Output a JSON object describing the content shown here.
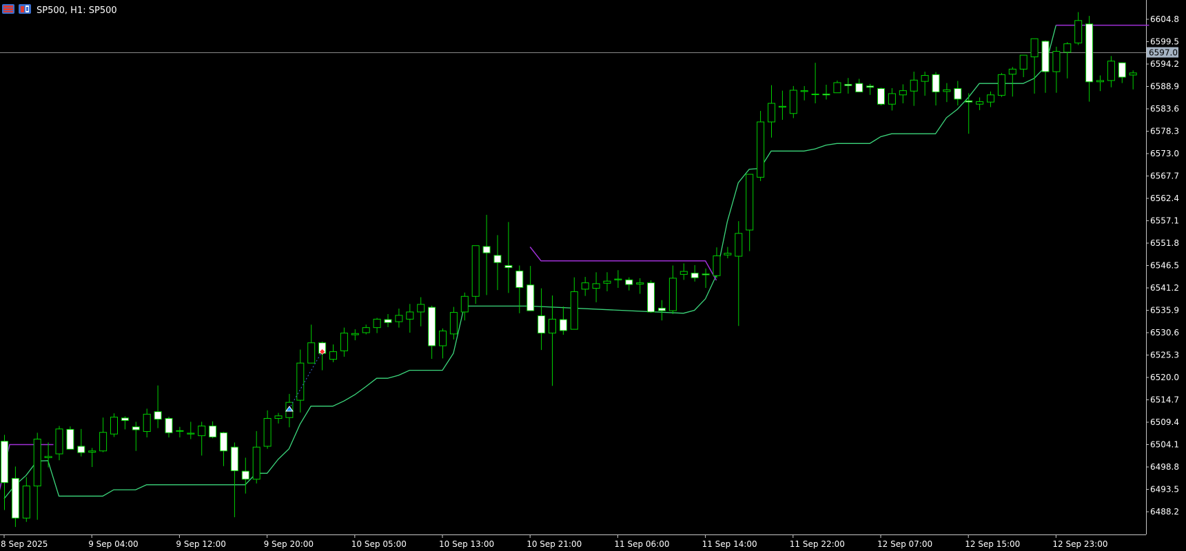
{
  "window": {
    "title": "SP500, H1:  SP500",
    "icons": [
      "chart-grid-icon",
      "one-click-trading-icon"
    ]
  },
  "colors": {
    "background": "#000000",
    "bull_body": "#000000",
    "bear_body": "#ffffff",
    "candle_wick": "#00d200",
    "lower_line": "#3cd77c",
    "upper_line": "#a030d8",
    "bid_line": "#8a8a8a",
    "axis": "#c8c8c8",
    "price_tag": "#a6b4c4",
    "buy_arrow": "#1e90ff",
    "sell_arrow": "#ff3030"
  },
  "chart_data": {
    "type": "candlestick",
    "symbol": "SP500",
    "timeframe": "H1",
    "current_price": "6597.0",
    "y_ticks": [
      "6604.8",
      "6599.5",
      "6594.2",
      "6588.9",
      "6583.6",
      "6578.3",
      "6573.0",
      "6567.7",
      "6562.4",
      "6557.1",
      "6551.8",
      "6546.5",
      "6541.2",
      "6535.9",
      "6530.6",
      "6525.3",
      "6520.0",
      "6514.7",
      "6509.4",
      "6504.1",
      "6498.8",
      "6493.5",
      "6488.2"
    ],
    "ylim": [
      6484.2,
      6607.3
    ],
    "x_ticks": [
      {
        "label": "8 Sep 2025",
        "bar": 0
      },
      {
        "label": "9 Sep 04:00",
        "bar": 8
      },
      {
        "label": "9 Sep 12:00",
        "bar": 16
      },
      {
        "label": "9 Sep 20:00",
        "bar": 24
      },
      {
        "label": "10 Sep 05:00",
        "bar": 32
      },
      {
        "label": "10 Sep 13:00",
        "bar": 40
      },
      {
        "label": "10 Sep 21:00",
        "bar": 48
      },
      {
        "label": "11 Sep 06:00",
        "bar": 56
      },
      {
        "label": "11 Sep 14:00",
        "bar": 64
      },
      {
        "label": "11 Sep 22:00",
        "bar": 72
      },
      {
        "label": "12 Sep 07:00",
        "bar": 80
      },
      {
        "label": "12 Sep 15:00",
        "bar": 88
      },
      {
        "label": "12 Sep 23:00",
        "bar": 96
      }
    ],
    "candles": [
      {
        "o": 6504.9,
        "h": 6506.4,
        "l": 6488.6,
        "c": 6495.1
      },
      {
        "o": 6496.1,
        "h": 6498.9,
        "l": 6484.6,
        "c": 6486.7
      },
      {
        "o": 6486.7,
        "h": 6496.4,
        "l": 6485.8,
        "c": 6494.3
      },
      {
        "o": 6494.3,
        "h": 6506.9,
        "l": 6486.3,
        "c": 6505.4
      },
      {
        "o": 6501.0,
        "h": 6504.6,
        "l": 6498.7,
        "c": 6501.3
      },
      {
        "o": 6501.9,
        "h": 6508.5,
        "l": 6500.4,
        "c": 6507.8
      },
      {
        "o": 6507.7,
        "h": 6508.4,
        "l": 6504.0,
        "c": 6503.0
      },
      {
        "o": 6503.7,
        "h": 6507.8,
        "l": 6501.3,
        "c": 6502.2
      },
      {
        "o": 6502.3,
        "h": 6503.3,
        "l": 6498.8,
        "c": 6502.6
      },
      {
        "o": 6502.6,
        "h": 6510.5,
        "l": 6502.3,
        "c": 6507.0
      },
      {
        "o": 6506.6,
        "h": 6511.5,
        "l": 6505.9,
        "c": 6510.6
      },
      {
        "o": 6510.4,
        "h": 6510.8,
        "l": 6507.7,
        "c": 6509.8
      },
      {
        "o": 6508.3,
        "h": 6509.5,
        "l": 6502.6,
        "c": 6507.6
      },
      {
        "o": 6507.2,
        "h": 6512.6,
        "l": 6505.8,
        "c": 6511.3
      },
      {
        "o": 6511.9,
        "h": 6518.1,
        "l": 6508.0,
        "c": 6510.1
      },
      {
        "o": 6510.3,
        "h": 6510.7,
        "l": 6505.8,
        "c": 6506.9
      },
      {
        "o": 6507.3,
        "h": 6508.3,
        "l": 6505.8,
        "c": 6507.4
      },
      {
        "o": 6506.6,
        "h": 6509.5,
        "l": 6505.4,
        "c": 6506.8
      },
      {
        "o": 6506.2,
        "h": 6509.5,
        "l": 6501.5,
        "c": 6508.5
      },
      {
        "o": 6508.5,
        "h": 6509.6,
        "l": 6505.6,
        "c": 6505.9
      },
      {
        "o": 6506.9,
        "h": 6507.1,
        "l": 6499.0,
        "c": 6502.6
      },
      {
        "o": 6503.5,
        "h": 6504.6,
        "l": 6486.9,
        "c": 6497.9
      },
      {
        "o": 6497.8,
        "h": 6501.0,
        "l": 6492.5,
        "c": 6495.9
      },
      {
        "o": 6495.9,
        "h": 6507.3,
        "l": 6494.9,
        "c": 6503.5
      },
      {
        "o": 6503.7,
        "h": 6512.2,
        "l": 6503.1,
        "c": 6510.3
      },
      {
        "o": 6510.3,
        "h": 6511.6,
        "l": 6509.1,
        "c": 6510.9
      },
      {
        "o": 6510.5,
        "h": 6516.1,
        "l": 6508.2,
        "c": 6514.1
      },
      {
        "o": 6514.6,
        "h": 6526.6,
        "l": 6511.7,
        "c": 6523.4
      },
      {
        "o": 6523.4,
        "h": 6532.5,
        "l": 6524.5,
        "c": 6528.2
      },
      {
        "o": 6528.2,
        "h": 6528.5,
        "l": 6521.7,
        "c": 6525.7
      },
      {
        "o": 6524.3,
        "h": 6527.8,
        "l": 6523.6,
        "c": 6526.1
      },
      {
        "o": 6526.3,
        "h": 6531.8,
        "l": 6524.9,
        "c": 6530.5
      },
      {
        "o": 6530.1,
        "h": 6531.4,
        "l": 6528.8,
        "c": 6530.4
      },
      {
        "o": 6530.6,
        "h": 6532.5,
        "l": 6530.2,
        "c": 6531.8
      },
      {
        "o": 6531.8,
        "h": 6534.1,
        "l": 6530.5,
        "c": 6533.8
      },
      {
        "o": 6533.7,
        "h": 6535.0,
        "l": 6531.9,
        "c": 6533.0
      },
      {
        "o": 6533.2,
        "h": 6536.3,
        "l": 6531.8,
        "c": 6534.7
      },
      {
        "o": 6533.8,
        "h": 6537.4,
        "l": 6530.6,
        "c": 6535.5
      },
      {
        "o": 6535.5,
        "h": 6539.0,
        "l": 6532.1,
        "c": 6537.3
      },
      {
        "o": 6536.6,
        "h": 6537.0,
        "l": 6524.4,
        "c": 6527.5
      },
      {
        "o": 6527.5,
        "h": 6531.6,
        "l": 6524.5,
        "c": 6531.0
      },
      {
        "o": 6530.3,
        "h": 6536.7,
        "l": 6529.0,
        "c": 6535.4
      },
      {
        "o": 6535.5,
        "h": 6540.1,
        "l": 6533.5,
        "c": 6539.2
      },
      {
        "o": 6539.2,
        "h": 6550.7,
        "l": 6537.4,
        "c": 6551.2
      },
      {
        "o": 6551.0,
        "h": 6558.5,
        "l": 6539.5,
        "c": 6549.5
      },
      {
        "o": 6548.9,
        "h": 6553.7,
        "l": 6540.7,
        "c": 6547.2
      },
      {
        "o": 6546.5,
        "h": 6556.8,
        "l": 6540.0,
        "c": 6546.0
      },
      {
        "o": 6545.2,
        "h": 6546.5,
        "l": 6535.2,
        "c": 6541.3
      },
      {
        "o": 6541.9,
        "h": 6546.4,
        "l": 6536.5,
        "c": 6535.8
      },
      {
        "o": 6534.6,
        "h": 6541.1,
        "l": 6526.5,
        "c": 6530.5
      },
      {
        "o": 6530.5,
        "h": 6539.4,
        "l": 6518.0,
        "c": 6533.8
      },
      {
        "o": 6533.7,
        "h": 6536.8,
        "l": 6530.1,
        "c": 6531.1
      },
      {
        "o": 6531.4,
        "h": 6543.7,
        "l": 6533.4,
        "c": 6540.3
      },
      {
        "o": 6540.9,
        "h": 6543.8,
        "l": 6539.3,
        "c": 6542.4
      },
      {
        "o": 6541.1,
        "h": 6544.9,
        "l": 6537.8,
        "c": 6542.2
      },
      {
        "o": 6542.3,
        "h": 6544.9,
        "l": 6540.4,
        "c": 6542.8
      },
      {
        "o": 6543.1,
        "h": 6545.4,
        "l": 6541.2,
        "c": 6543.3
      },
      {
        "o": 6543.1,
        "h": 6543.7,
        "l": 6540.6,
        "c": 6542.0
      },
      {
        "o": 6542.1,
        "h": 6543.5,
        "l": 6539.8,
        "c": 6542.4
      },
      {
        "o": 6542.4,
        "h": 6543.0,
        "l": 6535.3,
        "c": 6535.5
      },
      {
        "o": 6536.4,
        "h": 6538.3,
        "l": 6533.5,
        "c": 6535.8
      },
      {
        "o": 6535.8,
        "h": 6546.5,
        "l": 6535.0,
        "c": 6543.5
      },
      {
        "o": 6544.4,
        "h": 6547.0,
        "l": 6543.1,
        "c": 6545.1
      },
      {
        "o": 6544.7,
        "h": 6546.6,
        "l": 6542.7,
        "c": 6543.6
      },
      {
        "o": 6544.5,
        "h": 6545.8,
        "l": 6541.2,
        "c": 6544.3
      },
      {
        "o": 6544.1,
        "h": 6550.8,
        "l": 6543.5,
        "c": 6548.8
      },
      {
        "o": 6549.0,
        "h": 6550.9,
        "l": 6548.2,
        "c": 6549.4
      },
      {
        "o": 6548.7,
        "h": 6557.0,
        "l": 6532.2,
        "c": 6554.1
      },
      {
        "o": 6554.9,
        "h": 6560.8,
        "l": 6549.9,
        "c": 6568.1
      },
      {
        "o": 6567.4,
        "h": 6583.1,
        "l": 6566.5,
        "c": 6580.5
      },
      {
        "o": 6580.5,
        "h": 6589.2,
        "l": 6576.8,
        "c": 6584.9
      },
      {
        "o": 6584.0,
        "h": 6587.9,
        "l": 6581.0,
        "c": 6584.2
      },
      {
        "o": 6582.5,
        "h": 6589.0,
        "l": 6581.4,
        "c": 6588.0
      },
      {
        "o": 6587.7,
        "h": 6589.0,
        "l": 6585.6,
        "c": 6587.9
      },
      {
        "o": 6587.0,
        "h": 6594.5,
        "l": 6584.9,
        "c": 6587.1
      },
      {
        "o": 6587.1,
        "h": 6589.3,
        "l": 6585.8,
        "c": 6586.9
      },
      {
        "o": 6587.4,
        "h": 6590.3,
        "l": 6587.5,
        "c": 6589.8
      },
      {
        "o": 6589.4,
        "h": 6590.9,
        "l": 6587.2,
        "c": 6589.1
      },
      {
        "o": 6589.6,
        "h": 6590.7,
        "l": 6587.6,
        "c": 6587.6
      },
      {
        "o": 6589.0,
        "h": 6589.5,
        "l": 6586.9,
        "c": 6588.7
      },
      {
        "o": 6588.4,
        "h": 6588.6,
        "l": 6584.4,
        "c": 6584.7
      },
      {
        "o": 6584.7,
        "h": 6588.5,
        "l": 6583.2,
        "c": 6587.2
      },
      {
        "o": 6586.9,
        "h": 6589.4,
        "l": 6584.9,
        "c": 6587.9
      },
      {
        "o": 6587.8,
        "h": 6592.4,
        "l": 6584.3,
        "c": 6590.4
      },
      {
        "o": 6590.1,
        "h": 6592.4,
        "l": 6586.7,
        "c": 6591.5
      },
      {
        "o": 6591.7,
        "h": 6592.3,
        "l": 6584.4,
        "c": 6587.6
      },
      {
        "o": 6587.7,
        "h": 6589.7,
        "l": 6585.2,
        "c": 6588.1
      },
      {
        "o": 6588.4,
        "h": 6590.2,
        "l": 6584.4,
        "c": 6585.9
      },
      {
        "o": 6585.5,
        "h": 6587.3,
        "l": 6577.7,
        "c": 6585.2
      },
      {
        "o": 6584.7,
        "h": 6586.3,
        "l": 6583.3,
        "c": 6585.3
      },
      {
        "o": 6585.2,
        "h": 6587.7,
        "l": 6584.0,
        "c": 6586.9
      },
      {
        "o": 6586.8,
        "h": 6592.1,
        "l": 6586.4,
        "c": 6591.7
      },
      {
        "o": 6591.8,
        "h": 6593.5,
        "l": 6586.5,
        "c": 6593.0
      },
      {
        "o": 6593.0,
        "h": 6594.6,
        "l": 6591.1,
        "c": 6596.3
      },
      {
        "o": 6595.9,
        "h": 6599.8,
        "l": 6587.2,
        "c": 6600.2
      },
      {
        "o": 6599.6,
        "h": 6599.8,
        "l": 6587.4,
        "c": 6592.4
      },
      {
        "o": 6592.4,
        "h": 6598.3,
        "l": 6587.4,
        "c": 6597.2
      },
      {
        "o": 6597.0,
        "h": 6599.4,
        "l": 6590.8,
        "c": 6599.0
      },
      {
        "o": 6599.2,
        "h": 6606.5,
        "l": 6598.7,
        "c": 6604.5
      },
      {
        "o": 6603.7,
        "h": 6605.6,
        "l": 6585.3,
        "c": 6590.0
      },
      {
        "o": 6590.0,
        "h": 6591.5,
        "l": 6587.8,
        "c": 6590.3
      },
      {
        "o": 6590.3,
        "h": 6596.1,
        "l": 6588.7,
        "c": 6594.9
      },
      {
        "o": 6594.5,
        "h": 6594.6,
        "l": 6589.7,
        "c": 6591.1
      },
      {
        "o": 6591.6,
        "h": 6592.7,
        "l": 6588.2,
        "c": 6592.1
      },
      {
        "o": 6592.1,
        "h": 6594.1,
        "l": 6590.9,
        "c": 6593.6
      },
      {
        "o": 6593.6,
        "h": 6596.2,
        "l": 6592.1,
        "c": 6595.6
      },
      {
        "o": 6595.2,
        "h": 6597.4,
        "l": 6595.4,
        "c": 6597.0
      }
    ],
    "lower_line": [
      {
        "bar": 0,
        "v": 6491.3
      },
      {
        "bar": 1,
        "v": 6494.5
      },
      {
        "bar": 2,
        "v": 6496.8
      },
      {
        "bar": 3,
        "v": 6500.2
      },
      {
        "bar": 4,
        "v": 6500.3
      },
      {
        "bar": 5,
        "v": 6491.9
      },
      {
        "bar": 6,
        "v": 6491.9
      },
      {
        "bar": 7,
        "v": 6491.9
      },
      {
        "bar": 8,
        "v": 6491.9
      },
      {
        "bar": 9,
        "v": 6491.9
      },
      {
        "bar": 10,
        "v": 6493.4
      },
      {
        "bar": 11,
        "v": 6493.4
      },
      {
        "bar": 12,
        "v": 6493.4
      },
      {
        "bar": 13,
        "v": 6494.6
      },
      {
        "bar": 14,
        "v": 6494.6
      },
      {
        "bar": 22,
        "v": 6494.6
      },
      {
        "bar": 23,
        "v": 6497.3
      },
      {
        "bar": 24,
        "v": 6497.3
      },
      {
        "bar": 25,
        "v": 6500.6
      },
      {
        "bar": 26,
        "v": 6503.1
      },
      {
        "bar": 27,
        "v": 6508.9
      },
      {
        "bar": 28,
        "v": 6513.2
      },
      {
        "bar": 29,
        "v": 6513.2
      },
      {
        "bar": 30,
        "v": 6513.2
      },
      {
        "bar": 31,
        "v": 6514.4
      },
      {
        "bar": 32,
        "v": 6515.9
      },
      {
        "bar": 33,
        "v": 6517.8
      },
      {
        "bar": 34,
        "v": 6519.8
      },
      {
        "bar": 35,
        "v": 6519.8
      },
      {
        "bar": 36,
        "v": 6520.5
      },
      {
        "bar": 37,
        "v": 6521.7
      },
      {
        "bar": 38,
        "v": 6521.7
      },
      {
        "bar": 39,
        "v": 6521.7
      },
      {
        "bar": 40,
        "v": 6521.7
      },
      {
        "bar": 41,
        "v": 6525.7
      },
      {
        "bar": 42,
        "v": 6536.9
      },
      {
        "bar": 43,
        "v": 6536.9
      },
      {
        "bar": 44,
        "v": 6536.9
      },
      {
        "bar": 45,
        "v": 6536.9
      },
      {
        "bar": 46,
        "v": 6536.9
      },
      {
        "bar": 47,
        "v": 6536.9
      },
      {
        "bar": 48,
        "v": 6536.9
      },
      {
        "bar": 62,
        "v": 6535.2
      },
      {
        "bar": 63,
        "v": 6535.9
      },
      {
        "bar": 64,
        "v": 6538.6
      },
      {
        "bar": 65,
        "v": 6544.2
      },
      {
        "bar": 66,
        "v": 6556.9
      },
      {
        "bar": 67,
        "v": 6566.1
      },
      {
        "bar": 68,
        "v": 6569.3
      },
      {
        "bar": 69,
        "v": 6569.5
      },
      {
        "bar": 70,
        "v": 6573.6
      },
      {
        "bar": 71,
        "v": 6573.6
      },
      {
        "bar": 72,
        "v": 6573.6
      },
      {
        "bar": 73,
        "v": 6573.6
      },
      {
        "bar": 74,
        "v": 6574.1
      },
      {
        "bar": 75,
        "v": 6575.0
      },
      {
        "bar": 76,
        "v": 6575.4
      },
      {
        "bar": 77,
        "v": 6575.4
      },
      {
        "bar": 78,
        "v": 6575.4
      },
      {
        "bar": 79,
        "v": 6575.4
      },
      {
        "bar": 80,
        "v": 6577.0
      },
      {
        "bar": 81,
        "v": 6577.7
      },
      {
        "bar": 82,
        "v": 6577.7
      },
      {
        "bar": 83,
        "v": 6577.7
      },
      {
        "bar": 84,
        "v": 6577.7
      },
      {
        "bar": 85,
        "v": 6577.7
      },
      {
        "bar": 86,
        "v": 6581.5
      },
      {
        "bar": 87,
        "v": 6583.5
      },
      {
        "bar": 88,
        "v": 6586.3
      },
      {
        "bar": 89,
        "v": 6589.6
      },
      {
        "bar": 90,
        "v": 6589.6
      },
      {
        "bar": 91,
        "v": 6589.6
      },
      {
        "bar": 92,
        "v": 6589.6
      },
      {
        "bar": 93,
        "v": 6589.6
      },
      {
        "bar": 94,
        "v": 6590.8
      },
      {
        "bar": 95,
        "v": 6593.5
      },
      {
        "bar": 96,
        "v": 6603.4
      }
    ],
    "upper_line_segments": [
      [
        {
          "bar": -0.5,
          "v": 6492.3
        },
        {
          "bar": 0.5,
          "v": 6504.1
        },
        {
          "bar": 4.5,
          "v": 6504.1
        }
      ],
      [
        {
          "bar": 48,
          "v": 6550.9
        },
        {
          "bar": 49,
          "v": 6547.6
        },
        {
          "bar": 64,
          "v": 6547.6
        },
        {
          "bar": 65,
          "v": 6543.0
        }
      ],
      [
        {
          "bar": 96,
          "v": 6603.4
        },
        {
          "bar": 104.5,
          "v": 6603.4
        }
      ]
    ],
    "markers": [
      {
        "type": "buy",
        "bar": 26,
        "price": 6512.5
      },
      {
        "type": "sell",
        "bar": 29,
        "price": 6526.1
      }
    ],
    "trade_link": {
      "from_bar": 26,
      "from_price": 6512.5,
      "to_bar": 29,
      "to_price": 6526.1
    }
  }
}
